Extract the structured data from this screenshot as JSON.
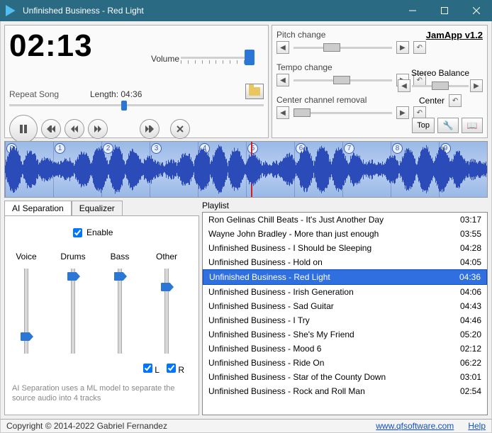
{
  "window": {
    "title": "Unfinished Business - Red Light"
  },
  "player": {
    "time": "02:13",
    "volume_label": "Volume",
    "repeat_label": "Repeat Song",
    "length_label": "Length: 04:36"
  },
  "right": {
    "pitch_label": "Pitch change",
    "tempo_label": "Tempo change",
    "center_label": "Center channel removal",
    "app_title": "JamApp v1.2",
    "stereo_label": "Stereo Balance",
    "center_text": "Center",
    "top_btn": "Top"
  },
  "tabs": {
    "tab1": "AI Separation",
    "tab2": "Equalizer",
    "enable_label": "Enable",
    "sliders": [
      "Voice",
      "Drums",
      "Bass",
      "Other"
    ],
    "positions": [
      90,
      5,
      5,
      20
    ],
    "l_label": "L",
    "r_label": "R",
    "hint": "AI Separation uses a ML model to separate the source audio into 4 tracks"
  },
  "playlist": {
    "label": "Playlist",
    "selected": 4,
    "items": [
      {
        "title": "Ron Gelinas Chill Beats - It's Just Another Day",
        "dur": "03:17"
      },
      {
        "title": "Wayne John Bradley - More than just enough",
        "dur": "03:55"
      },
      {
        "title": "Unfinished Business - I Should be Sleeping",
        "dur": "04:28"
      },
      {
        "title": "Unfinished Business - Hold on",
        "dur": "04:05"
      },
      {
        "title": "Unfinished Business - Red Light",
        "dur": "04:36"
      },
      {
        "title": "Unfinished Business - Irish Generation",
        "dur": "04:06"
      },
      {
        "title": "Unfinished Business - Sad Guitar",
        "dur": "04:43"
      },
      {
        "title": "Unfinished Business - I Try",
        "dur": "04:46"
      },
      {
        "title": "Unfinished Business - She's My Friend",
        "dur": "05:20"
      },
      {
        "title": "Unfinished Business - Mood 6",
        "dur": "02:12"
      },
      {
        "title": "Unfinished Business - Ride On",
        "dur": "06:22"
      },
      {
        "title": "Unfinished Business - Star of the County Down",
        "dur": "03:01"
      },
      {
        "title": "Unfinished Business - Rock and Roll Man",
        "dur": "02:54"
      }
    ]
  },
  "footer": {
    "copyright": "Copyright © 2014-2022 Gabriel Fernandez",
    "link": "www.qfsoftware.com",
    "help": "Help"
  },
  "wave": {
    "markers": 10,
    "playhead_pct": 51
  }
}
